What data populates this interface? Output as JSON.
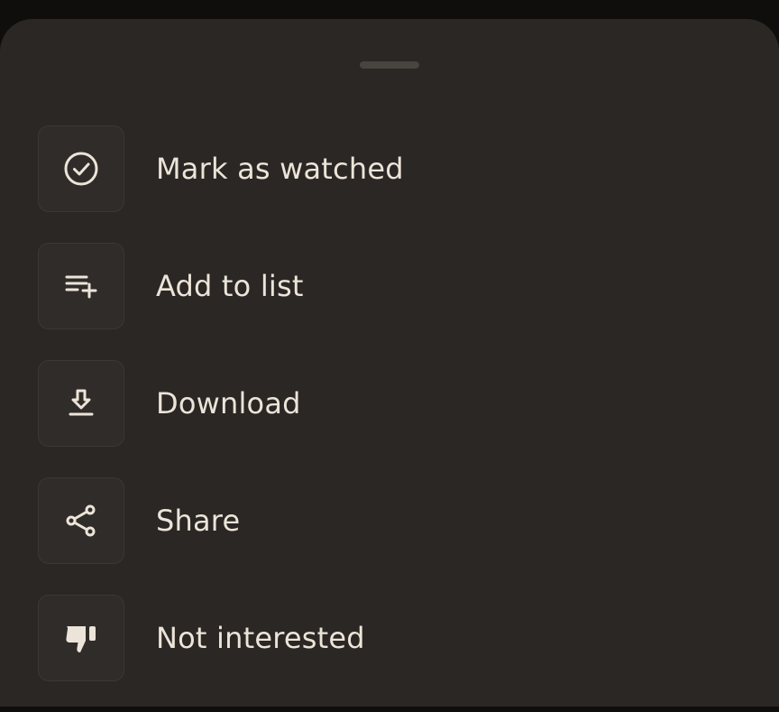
{
  "sheet": {
    "items": [
      {
        "label": "Mark as watched",
        "icon": "check-circle-icon"
      },
      {
        "label": "Add to list",
        "icon": "playlist-add-icon"
      },
      {
        "label": "Download",
        "icon": "download-icon"
      },
      {
        "label": "Share",
        "icon": "share-icon"
      },
      {
        "label": "Not interested",
        "icon": "thumbs-down-icon"
      }
    ]
  },
  "colors": {
    "background": "#0f0e0c",
    "sheet": "#2a2724",
    "icon_box": "#2f2c29",
    "text": "#ece4d9",
    "handle": "#48443f"
  }
}
